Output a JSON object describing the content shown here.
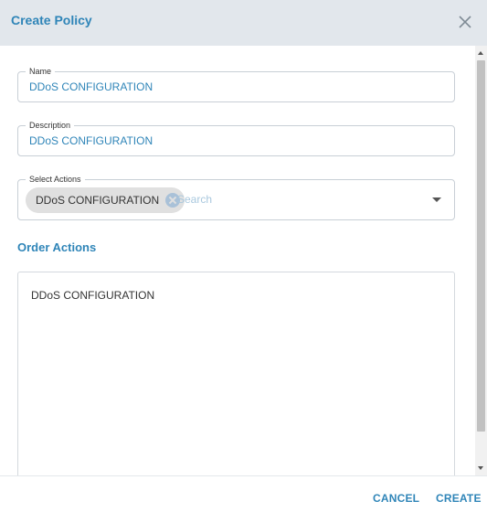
{
  "dialog": {
    "title": "Create Policy"
  },
  "form": {
    "name": {
      "label": "Name",
      "value": "DDoS CONFIGURATION"
    },
    "description": {
      "label": "Description",
      "value": "DDoS CONFIGURATION"
    },
    "select_actions": {
      "label": "Select Actions",
      "chips": [
        "DDoS CONFIGURATION"
      ],
      "search_placeholder": "Search"
    }
  },
  "order_actions": {
    "title": "Order Actions",
    "items": [
      "DDoS CONFIGURATION"
    ]
  },
  "footer": {
    "cancel_label": "CANCEL",
    "create_label": "CREATE"
  },
  "colors": {
    "accent": "#2f85b8",
    "header_bg": "#e2e7ec",
    "chip_bg": "#e0e0e0"
  }
}
